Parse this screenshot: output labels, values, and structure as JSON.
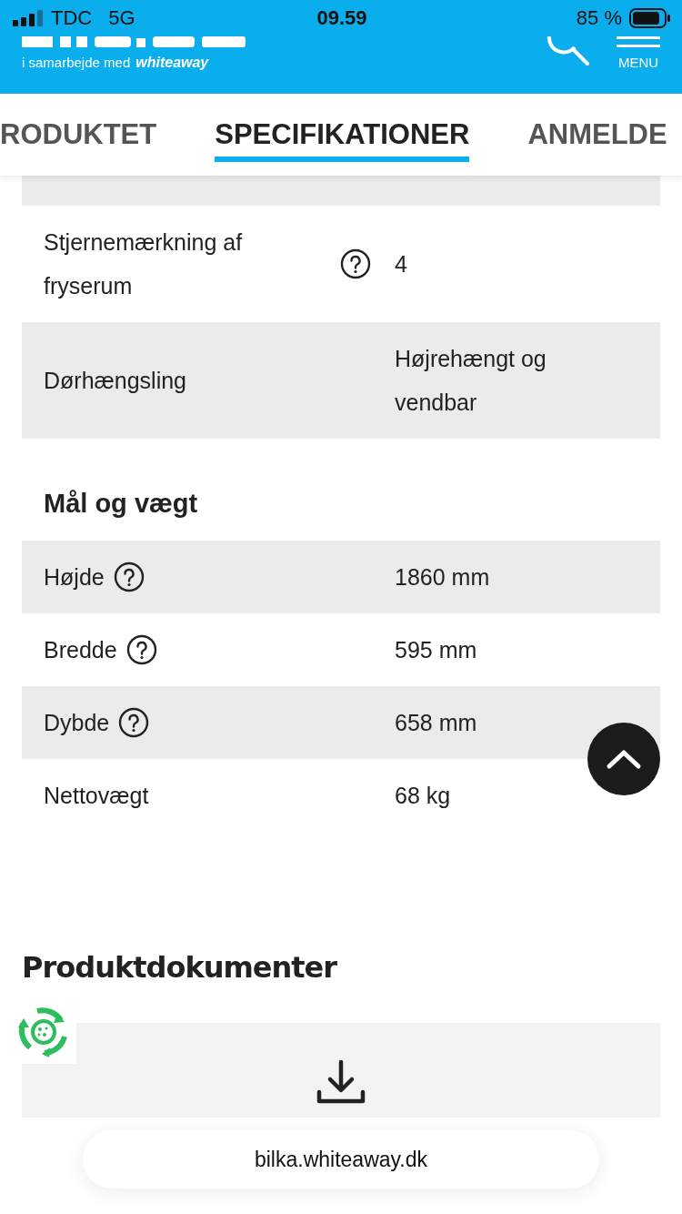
{
  "status_bar": {
    "carrier": "TDC",
    "network": "5G",
    "time": "09.59",
    "battery": "85 %"
  },
  "header": {
    "tagline": "i samarbejde med",
    "partner": "whiteaway",
    "menu_label": "MENU"
  },
  "tabs": [
    {
      "label": "RODUKTET",
      "selected": false
    },
    {
      "label": "SPECIFIKATIONER",
      "selected": true
    },
    {
      "label": "ANMELDE",
      "selected": false
    }
  ],
  "spec_rows": [
    {
      "label": "Stjernemærkning af fryserum",
      "help": true,
      "value": "4"
    },
    {
      "label": "Dørhængsling",
      "help": false,
      "value": "Højrehængt og vendbar"
    }
  ],
  "section": {
    "title": "Mål og vægt",
    "rows": [
      {
        "label": "Højde",
        "help": true,
        "value": "1860 mm"
      },
      {
        "label": "Bredde",
        "help": true,
        "value": "595 mm"
      },
      {
        "label": "Dybde",
        "help": true,
        "value": "658 mm"
      },
      {
        "label": "Nettovægt",
        "help": false,
        "value": "68 kg"
      }
    ]
  },
  "documents": {
    "title": "Produktdokumenter"
  },
  "address_bar": {
    "url": "bilka.whiteaway.dk"
  }
}
